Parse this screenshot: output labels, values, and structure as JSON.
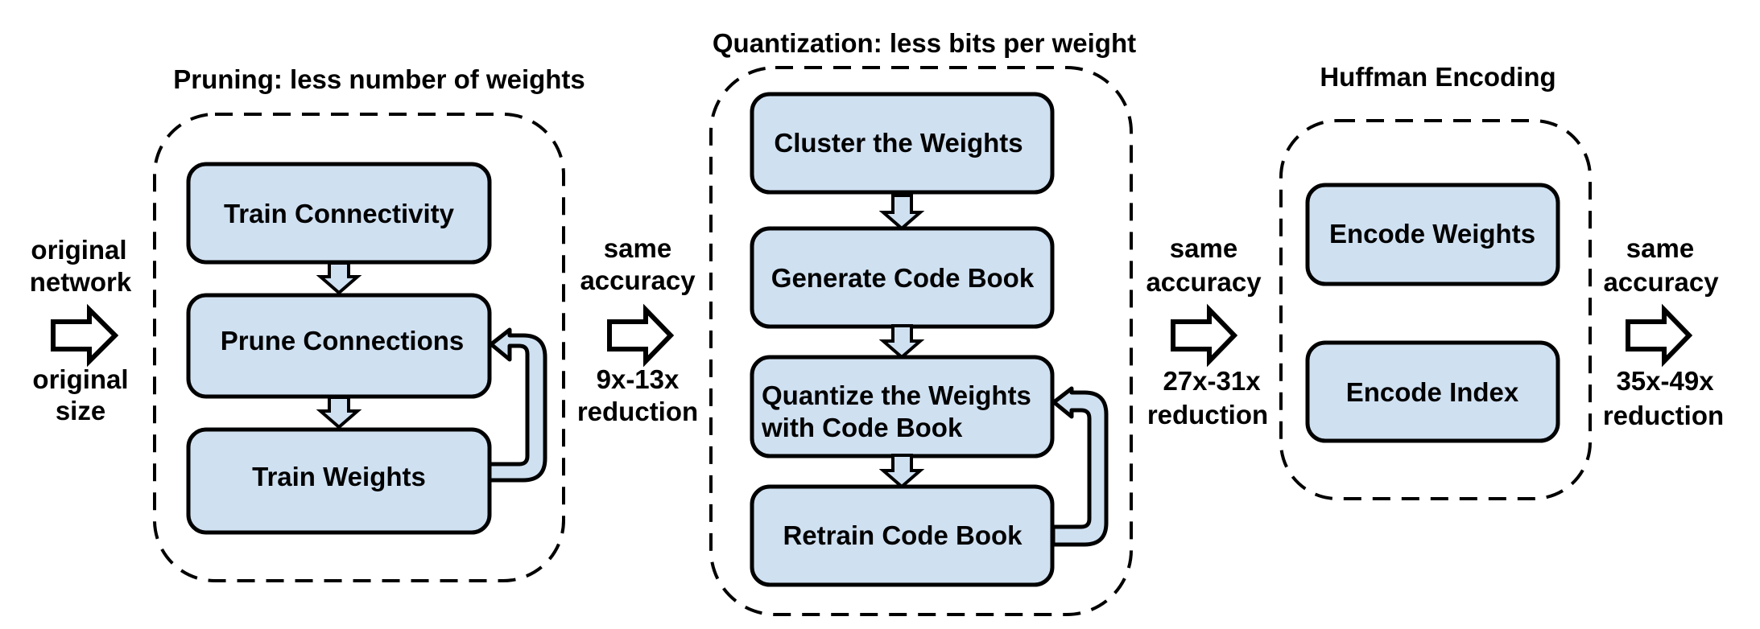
{
  "colors": {
    "box_fill": "#cfe0f1",
    "stroke": "#000000",
    "background": "#ffffff"
  },
  "input": {
    "top_lines": [
      "original",
      "network"
    ],
    "bottom_lines": [
      "original",
      "size"
    ]
  },
  "stages": [
    {
      "id": "pruning",
      "title": "Pruning: less number of weights",
      "steps": [
        {
          "label_lines": [
            "Train Connectivity"
          ]
        },
        {
          "label_lines": [
            "Prune Connections"
          ]
        },
        {
          "label_lines": [
            "Train Weights"
          ]
        }
      ],
      "feedback_loop": {
        "from": "Train Weights",
        "to": "Prune Connections"
      },
      "output": {
        "top_lines": [
          "same",
          "accuracy"
        ],
        "bottom_lines": [
          "9x-13x",
          "reduction"
        ]
      }
    },
    {
      "id": "quantization",
      "title": "Quantization: less bits per weight",
      "steps": [
        {
          "label_lines": [
            "Cluster the Weights"
          ]
        },
        {
          "label_lines": [
            "Generate Code Book"
          ]
        },
        {
          "label_lines": [
            "Quantize the Weights",
            "with Code Book"
          ]
        },
        {
          "label_lines": [
            "Retrain Code Book"
          ]
        }
      ],
      "feedback_loop": {
        "from": "Retrain Code Book",
        "to": "Quantize the Weights with Code Book"
      },
      "output": {
        "top_lines": [
          "same",
          "accuracy"
        ],
        "bottom_lines": [
          "27x-31x",
          "reduction"
        ]
      }
    },
    {
      "id": "huffman",
      "title": "Huffman Encoding",
      "steps": [
        {
          "label_lines": [
            "Encode Weights"
          ]
        },
        {
          "label_lines": [
            "Encode Index"
          ]
        }
      ],
      "output": {
        "top_lines": [
          "same",
          "accuracy"
        ],
        "bottom_lines": [
          "35x-49x",
          "reduction"
        ]
      }
    }
  ]
}
